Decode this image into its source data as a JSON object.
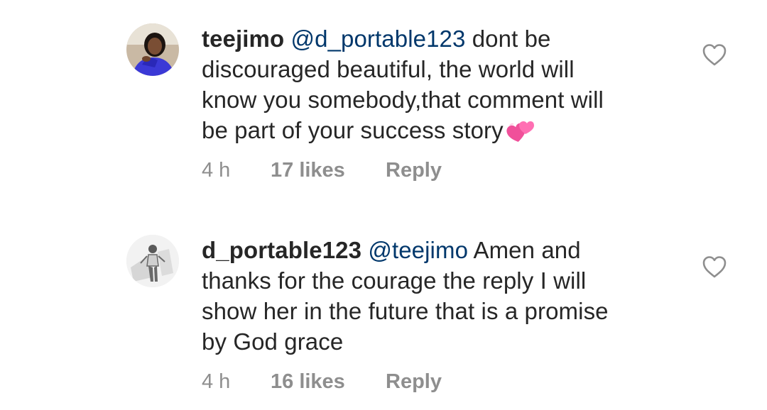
{
  "comments": [
    {
      "username": "teejimo",
      "mention": "@d_portable123",
      "lines": [
        " dont be",
        "discouraged beautiful, the world will",
        "know you somebody,that comment will",
        "be part of your success story"
      ],
      "emoji": "two-hearts-emoji",
      "time": "4 h",
      "likes": "17 likes",
      "reply": "Reply"
    },
    {
      "username": "d_portable123",
      "mention": "@teejimo",
      "lines": [
        " Amen and",
        "thanks for the courage the reply I will",
        "show her in the future that is a promise",
        "by God grace"
      ],
      "time": "4 h",
      "likes": "16 likes",
      "reply": "Reply"
    }
  ],
  "colors": {
    "text": "#262626",
    "mention": "#00376b",
    "meta": "#8e8e8e",
    "heart_outline": "#8e8e8e",
    "emoji_pink": "#f0509a"
  }
}
